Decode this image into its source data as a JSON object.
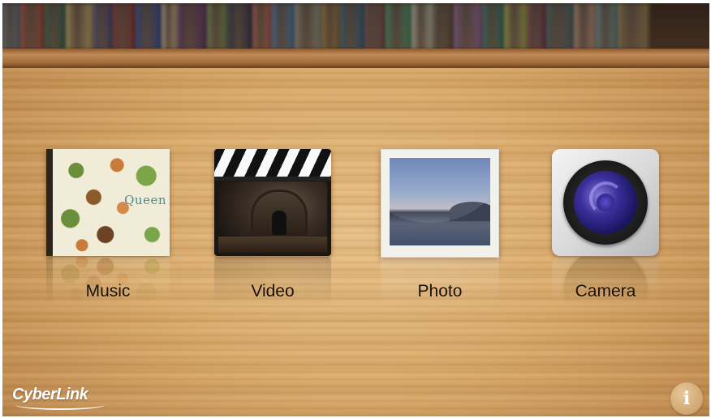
{
  "shelf": {
    "book_colors": [
      "#4a5a6a",
      "#7a3a2a",
      "#2a4a3a",
      "#8a7a4a",
      "#3a3a5a",
      "#6a2a2a",
      "#2a3a6a",
      "#9a8a6a",
      "#4a2a4a",
      "#5a6a3a",
      "#2a2a3a",
      "#8a4a3a",
      "#3a5a7a",
      "#6a6a5a",
      "#7a5a2a",
      "#2a4a5a",
      "#5a3a3a",
      "#3a6a4a",
      "#8a8a7a",
      "#4a3a2a",
      "#6a4a6a",
      "#2a5a4a",
      "#7a7a3a",
      "#5a2a3a",
      "#3a4a4a",
      "#8a6a5a",
      "#4a6a6a",
      "#6a5a3a"
    ]
  },
  "tiles": [
    {
      "id": "music",
      "label": "Music",
      "icon": "album-cover-icon",
      "cover_text": "Queen"
    },
    {
      "id": "video",
      "label": "Video",
      "icon": "clapperboard-icon"
    },
    {
      "id": "photo",
      "label": "Photo",
      "icon": "photo-frame-icon"
    },
    {
      "id": "camera",
      "label": "Camera",
      "icon": "camera-lens-icon"
    }
  ],
  "logo": {
    "text": "CyberLink"
  },
  "info_button": {
    "label": "i"
  }
}
